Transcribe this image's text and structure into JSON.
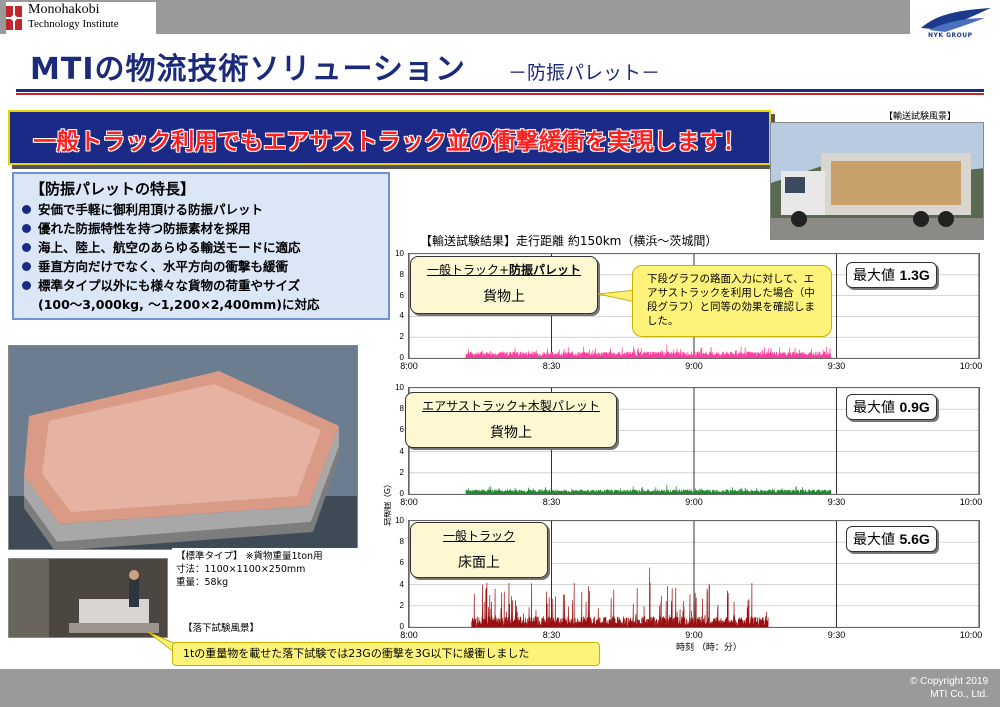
{
  "header": {
    "logo_line1": "Monohakobi",
    "logo_line2": "Technology Institute",
    "partner_logo": "NYK GROUP"
  },
  "title": "MTIの物流技術ソリューション",
  "subtitle": "－防振パレット－",
  "banner": "一般トラック利用でもエアサストラック並の衝撃緩衝を実現します！",
  "features": {
    "title": "【防振パレットの特長】",
    "items": [
      "安価で手軽に御利用頂ける防振パレット",
      "優れた防振特性を持つ防振素材を採用",
      "海上、陸上、航空のあらゆる輸送モードに適応",
      "垂直方向だけでなく、水平方向の衝撃も緩衝",
      "標準タイプ以外にも様々な貨物の荷重やサイズ"
    ],
    "continuation": "(100～3,000kg, ～1,200×2,400mm)に対応"
  },
  "photos": {
    "truck_caption": "【輸送試験風景】",
    "drop_caption": "【落下試験風景】"
  },
  "spec": {
    "line1": "【標準タイプ】 ※貨物重量1ton用",
    "line2": "寸法：1100×1100×250mm",
    "line3": "重量：58kg"
  },
  "note": "1tの重量物を載せた落下試験では23Gの衝撃を3G以下に緩衝しました",
  "graph_heading": "【輸送試験結果】走行距離 約150km（横浜～茨城間）",
  "callout": "下段グラフの路面入力に対して、エアサストラックを利用した場合（中段グラフ）と同等の効果を確認しました。",
  "axis": {
    "ylabel": "加速度（G）",
    "xlabel": "時刻 （時：分）",
    "yticks": [
      "0",
      "2",
      "4",
      "6",
      "8",
      "10"
    ],
    "xticks": [
      "8:00",
      "8:30",
      "9:00",
      "9:30",
      "10:00"
    ]
  },
  "plots": [
    {
      "label1a": "一般トラック+",
      "label1b": "防振パレット",
      "label2": "貨物上",
      "max_prefix": "最大値 ",
      "max_value": "1.3G",
      "color": "#ff3fa0"
    },
    {
      "label1": "エアサストラック+木製パレット",
      "label2": "貨物上",
      "max_prefix": "最大値 ",
      "max_value": "0.9G",
      "color": "#1f8a2e"
    },
    {
      "label1": "一般トラック",
      "label2": "床面上",
      "max_prefix": "最大値 ",
      "max_value": "5.6G",
      "color": "#9a1010"
    }
  ],
  "chart_data": [
    {
      "type": "line",
      "title": "一般トラック+防振パレット 貨物上",
      "xlabel": "時刻 （時：分）",
      "ylabel": "加速度（G）",
      "x_range": [
        "8:00",
        "10:00"
      ],
      "ylim": [
        0,
        10
      ],
      "max": 1.3,
      "grid": true
    },
    {
      "type": "line",
      "title": "エアサストラック+木製パレット 貨物上",
      "xlabel": "時刻 （時：分）",
      "ylabel": "加速度（G）",
      "x_range": [
        "8:00",
        "10:00"
      ],
      "ylim": [
        0,
        10
      ],
      "max": 0.9,
      "grid": true
    },
    {
      "type": "line",
      "title": "一般トラック 床面上",
      "xlabel": "時刻 （時：分）",
      "ylabel": "加速度（G）",
      "x_range": [
        "8:00",
        "10:00"
      ],
      "ylim": [
        0,
        10
      ],
      "max": 5.6,
      "grid": true
    }
  ],
  "footer": {
    "copyright_line1": "© Copyright 2019",
    "copyright_line2": "MTI Co., Ltd."
  }
}
